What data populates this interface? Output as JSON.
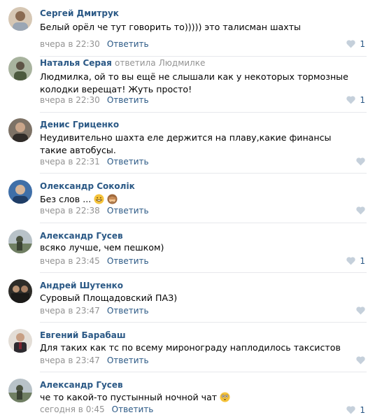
{
  "comments": [
    {
      "author": "Сергей Дмитрук",
      "reply_prefix": "",
      "reply_target": "",
      "text": "Белый орёл че тут говорить то))))) это талисман шахты",
      "time": "вчера в 22:30",
      "reply_label": "Ответить",
      "likes": "1",
      "avatar_color": "#c9b9a6"
    },
    {
      "author": "Наталья Серая",
      "reply_prefix": "ответила",
      "reply_target": "Людмилке",
      "text": "Людмилка, ой то вы ещё не слышали как у некоторых тормозные колодки верещат! Жуть просто!",
      "time": "вчера в 22:30",
      "reply_label": "Ответить",
      "likes": "1",
      "avatar_color": "#7f8e78"
    },
    {
      "author": "Денис Гриценко",
      "reply_prefix": "",
      "reply_target": "",
      "text": "Неудивительно шахта еле держится на плаву,какие финансы такие автобусы.",
      "time": "вчера в 22:31",
      "reply_label": "Ответить",
      "likes": "",
      "avatar_color": "#5a5048"
    },
    {
      "author": "Олександр Соколік",
      "reply_prefix": "",
      "reply_target": "",
      "text": "Без слов ...",
      "time": "вчера в 22:38",
      "reply_label": "Ответить",
      "likes": "",
      "avatar_color": "#3f6fa8",
      "emoji": [
        "grin-emoji",
        "see-no-evil-monkey-emoji"
      ]
    },
    {
      "author": "Александр Гусев",
      "reply_prefix": "",
      "reply_target": "",
      "text": "всяко лучше, чем пешком)",
      "time": "вчера в 23:45",
      "reply_label": "Ответить",
      "likes": "1",
      "avatar_color": "#8d9a8c"
    },
    {
      "author": "Андрей Шутенко",
      "reply_prefix": "",
      "reply_target": "",
      "text": "Суровый Площадовский ПАЗ)",
      "time": "вчера в 23:47",
      "reply_label": "Ответить",
      "likes": "",
      "avatar_color": "#3c3a34"
    },
    {
      "author": "Евгений Барабаш",
      "reply_prefix": "",
      "reply_target": "",
      "text": "Для таких как тс по всему мироноградy наплодилось таксистов",
      "time": "вчера в 23:47",
      "reply_label": "Ответить",
      "likes": "",
      "avatar_color": "#b9b2a9"
    },
    {
      "author": "Александр Гусев",
      "reply_prefix": "",
      "reply_target": "",
      "text": "че то какой-то пустынный ночной чат",
      "time": "сегодня в 0:45",
      "reply_label": "Ответить",
      "likes": "1",
      "avatar_color": "#8d9a8c",
      "emoji": [
        "flushed-emoji"
      ]
    }
  ],
  "colors": {
    "link": "#2a5885",
    "muted": "#939393",
    "like_icon": "#c5d0db",
    "separator": "#e7e8ec"
  }
}
